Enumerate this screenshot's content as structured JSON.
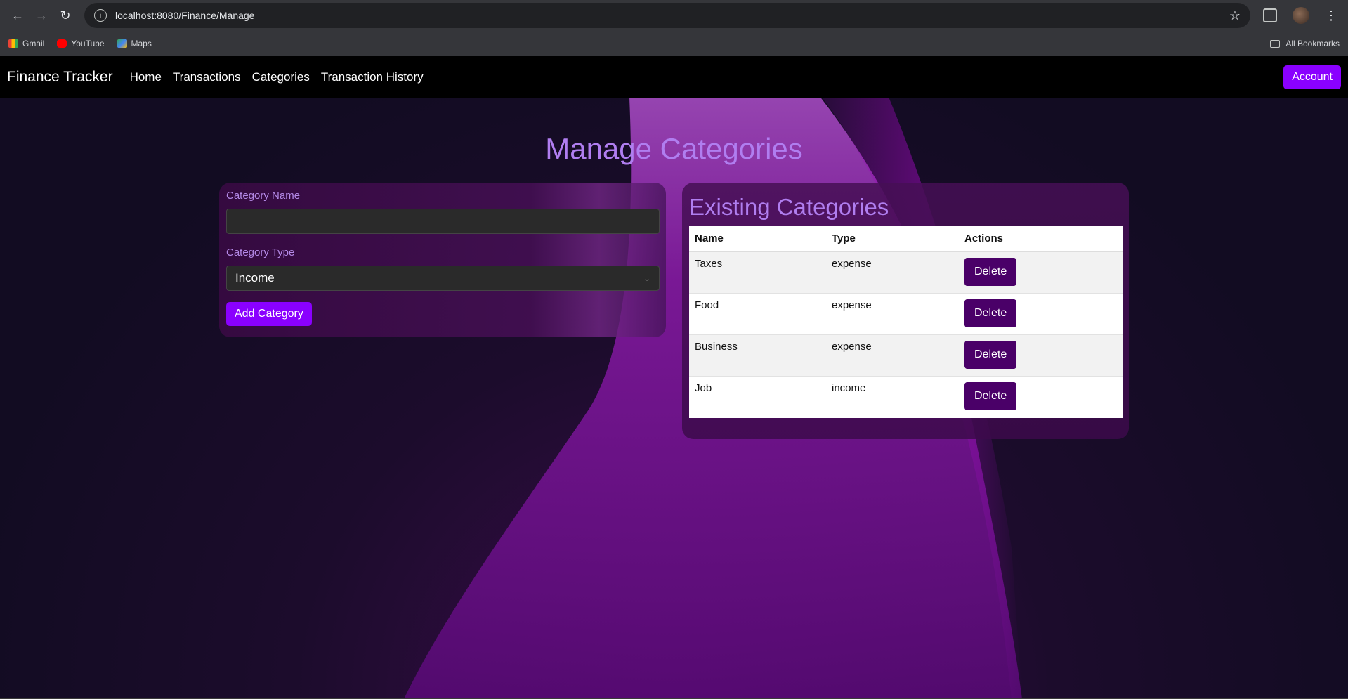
{
  "browser": {
    "url": "localhost:8080/Finance/Manage",
    "bookmarks": [
      "Gmail",
      "YouTube",
      "Maps"
    ],
    "all_bookmarks": "All Bookmarks"
  },
  "navbar": {
    "brand": "Finance Tracker",
    "links": [
      "Home",
      "Transactions",
      "Categories",
      "Transaction History"
    ],
    "account": "Account"
  },
  "page": {
    "title": "Manage Categories"
  },
  "form": {
    "name_label": "Category Name",
    "name_value": "",
    "type_label": "Category Type",
    "type_value": "Income",
    "submit": "Add Category"
  },
  "list": {
    "title": "Existing Categories",
    "headers": [
      "Name",
      "Type",
      "Actions"
    ],
    "rows": [
      {
        "name": "Taxes",
        "type": "expense",
        "action": "Delete"
      },
      {
        "name": "Food",
        "type": "expense",
        "action": "Delete"
      },
      {
        "name": "Business",
        "type": "expense",
        "action": "Delete"
      },
      {
        "name": "Job",
        "type": "income",
        "action": "Delete"
      }
    ]
  },
  "colors": {
    "accent": "#8a00ff",
    "delete": "#4a0068",
    "heading": "#b07ef0"
  }
}
